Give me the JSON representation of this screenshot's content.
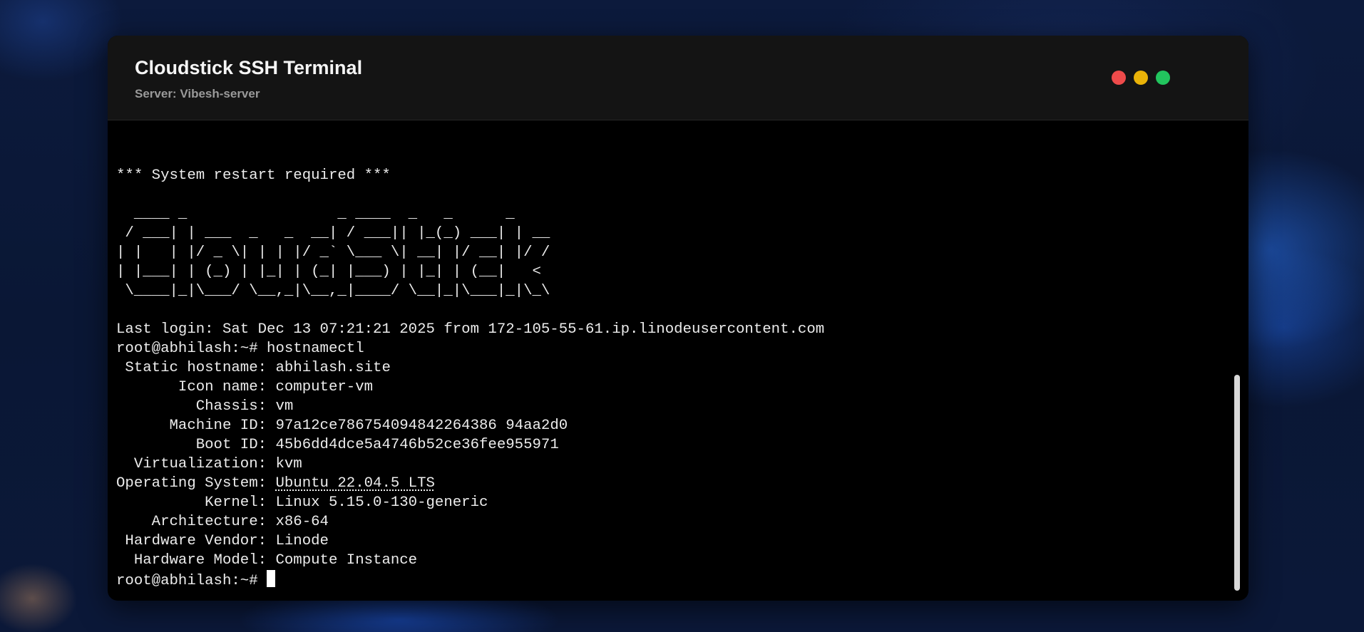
{
  "window": {
    "title": "Cloudstick SSH Terminal",
    "subtitle": "Server: Vibesh-server",
    "controls": [
      "close",
      "minimize",
      "maximize"
    ]
  },
  "terminal": {
    "restart_notice": "*** System restart required ***",
    "banner": [
      "  ____ _                 _ ____  _   _      _",
      " / ___| | ___  _   _  __| / ___|| |_(_) ___| | __",
      "| |   | |/ _ \\| | | |/ _` \\___ \\| __| |/ __| |/ /",
      "| |___| | (_) | |_| | (_| |___) | |_| | (__|   <",
      " \\____|_|\\___/ \\__,_|\\__,_|____/ \\__|_|\\___|_|\\_\\"
    ],
    "last_login": "Last login: Sat Dec 13 07:21:21 2025 from 172-105-55-61.ip.linodeusercontent.com",
    "prompt": "root@abhilash:~# ",
    "command": "hostnamectl",
    "info": {
      "static_hostname": {
        "label": " Static hostname: ",
        "value": "abhilash.site"
      },
      "icon_name": {
        "label": "       Icon name: ",
        "value": "computer-vm"
      },
      "chassis": {
        "label": "         Chassis: ",
        "value": "vm"
      },
      "machine_id": {
        "label": "      Machine ID: ",
        "value": "97a12ce786754094842264386 94aa2d0"
      },
      "boot_id": {
        "label": "         Boot ID: ",
        "value": "45b6dd4dce5a4746b52ce36fee955971"
      },
      "virtualization": {
        "label": "  Virtualization: ",
        "value": "kvm"
      },
      "operating_system": {
        "label": "Operating System: ",
        "value": "Ubuntu 22.04.5 LTS"
      },
      "kernel": {
        "label": "          Kernel: ",
        "value": "Linux 5.15.0-130-generic"
      },
      "architecture": {
        "label": "    Architecture: ",
        "value": "x86-64"
      },
      "hardware_vendor": {
        "label": " Hardware Vendor: ",
        "value": "Linode"
      },
      "hardware_model": {
        "label": "  Hardware Model: ",
        "value": "Compute Instance"
      }
    },
    "final_prompt": "root@abhilash:~# "
  },
  "colors": {
    "close": "#ee4b4b",
    "minimize": "#eab308",
    "maximize": "#22c55e",
    "terminal_bg": "#000000",
    "terminal_fg": "#ececec",
    "titlebar_bg": "#141414"
  }
}
